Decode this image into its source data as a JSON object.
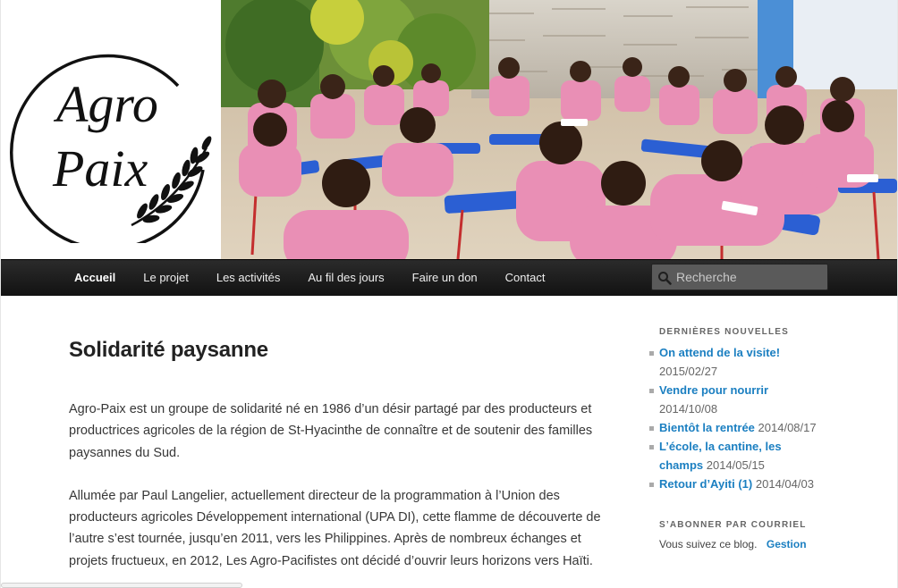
{
  "site": {
    "logo_line1": "Agro",
    "logo_line2": "Paix",
    "logo_alt": "Agro Paix logo",
    "hero_alt": "Schoolchildren in pink uniforms at blue desks"
  },
  "nav": {
    "items": [
      {
        "label": "Accueil",
        "active": true
      },
      {
        "label": "Le projet"
      },
      {
        "label": "Les activités"
      },
      {
        "label": "Au fil des jours"
      },
      {
        "label": "Faire un don"
      },
      {
        "label": "Contact"
      }
    ],
    "search_placeholder": "Recherche"
  },
  "post": {
    "title": "Solidarité paysanne",
    "paragraphs": [
      "Agro-Paix est un groupe de solidarité né en 1986 d’un désir partagé par des producteurs et productrices agricoles de la région de St-Hyacinthe de connaître et de soutenir des familles paysannes du Sud.",
      "Allumée par Paul Langelier, actuellement directeur de la programmation à l’Union des producteurs agricoles Développement international (UPA DI), cette flamme de découverte de l’autre s’est tournée, jusqu’en 2011, vers les Philippines. Après de nombreux échanges et projets fructueux, en 2012, Les Agro-Pacifistes ont décidé d’ouvrir leurs horizons vers Haïti."
    ]
  },
  "sidebar": {
    "news_title": "DERNIÈRES NOUVELLES",
    "news": [
      {
        "title": "On attend de la visite!",
        "date": "2015/02/27"
      },
      {
        "title": "Vendre pour nourrir",
        "date": "2014/10/08"
      },
      {
        "title": "Bientôt la rentrée",
        "date": "2014/08/17"
      },
      {
        "title": "L’école, la cantine, les champs",
        "date": "2014/05/15"
      },
      {
        "title": "Retour d’Ayiti (1)",
        "date": "2014/04/03"
      }
    ],
    "subscribe_title": "S’ABONNER PAR COURRIEL",
    "subscribe_text": "Vous suivez ce blog.",
    "subscribe_link": "Gestion"
  },
  "colors": {
    "link": "#1b7fc1",
    "nav_bg": "#1c1c1c",
    "uniform_pink": "#e98fb5",
    "desk_blue": "#2b5fd3"
  }
}
